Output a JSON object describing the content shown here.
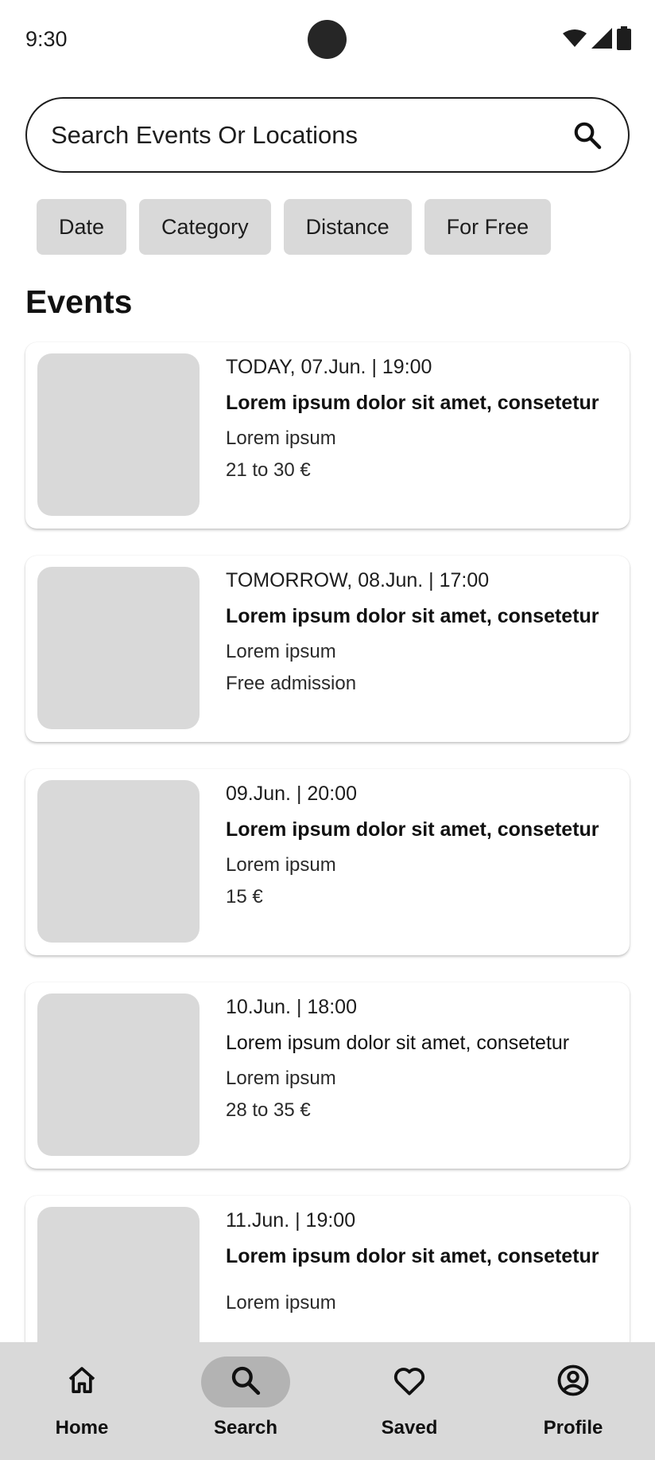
{
  "status_bar": {
    "time": "9:30",
    "icons": [
      "wifi-icon",
      "signal-icon",
      "battery-icon"
    ]
  },
  "search": {
    "placeholder": "Search Events Or Locations",
    "icon": "search-icon"
  },
  "filters": [
    {
      "label": "Date"
    },
    {
      "label": "Category"
    },
    {
      "label": "Distance"
    },
    {
      "label": "For Free"
    }
  ],
  "section_title": "Events",
  "events": [
    {
      "day": "TODAY, 07.Jun.",
      "time": "19:00",
      "title": "Lorem ipsum dolor sit amet, consetetur",
      "venue": "Lorem ipsum",
      "price": "21 to 30 €"
    },
    {
      "day": "TOMORROW, 08.Jun.",
      "time": "17:00",
      "title": "Lorem ipsum dolor sit amet, consetetur",
      "venue": "Lorem ipsum",
      "price": "Free admission"
    },
    {
      "day": "09.Jun.",
      "time": "20:00",
      "title": "Lorem ipsum dolor sit amet, consetetur",
      "venue": "Lorem ipsum",
      "price": "15 €"
    },
    {
      "day": "10.Jun.",
      "time": "18:00",
      "title": "Lorem ipsum dolor sit amet, consetetur",
      "venue": "Lorem ipsum",
      "price": "28 to 35 €"
    },
    {
      "day": "11.Jun.",
      "time": "19:00",
      "title": "Lorem ipsum dolor sit amet, consetetur",
      "venue": "Lorem ipsum",
      "price": ""
    }
  ],
  "nav": [
    {
      "label": "Home",
      "icon": "home-icon",
      "active": false
    },
    {
      "label": "Search",
      "icon": "search-icon",
      "active": true
    },
    {
      "label": "Saved",
      "icon": "heart-icon",
      "active": false
    },
    {
      "label": "Profile",
      "icon": "profile-icon",
      "active": false
    }
  ],
  "colors": {
    "placeholder_gray": "#d9d9d9",
    "active_nav": "#b3b3b3",
    "text": "#1d1d1d"
  }
}
